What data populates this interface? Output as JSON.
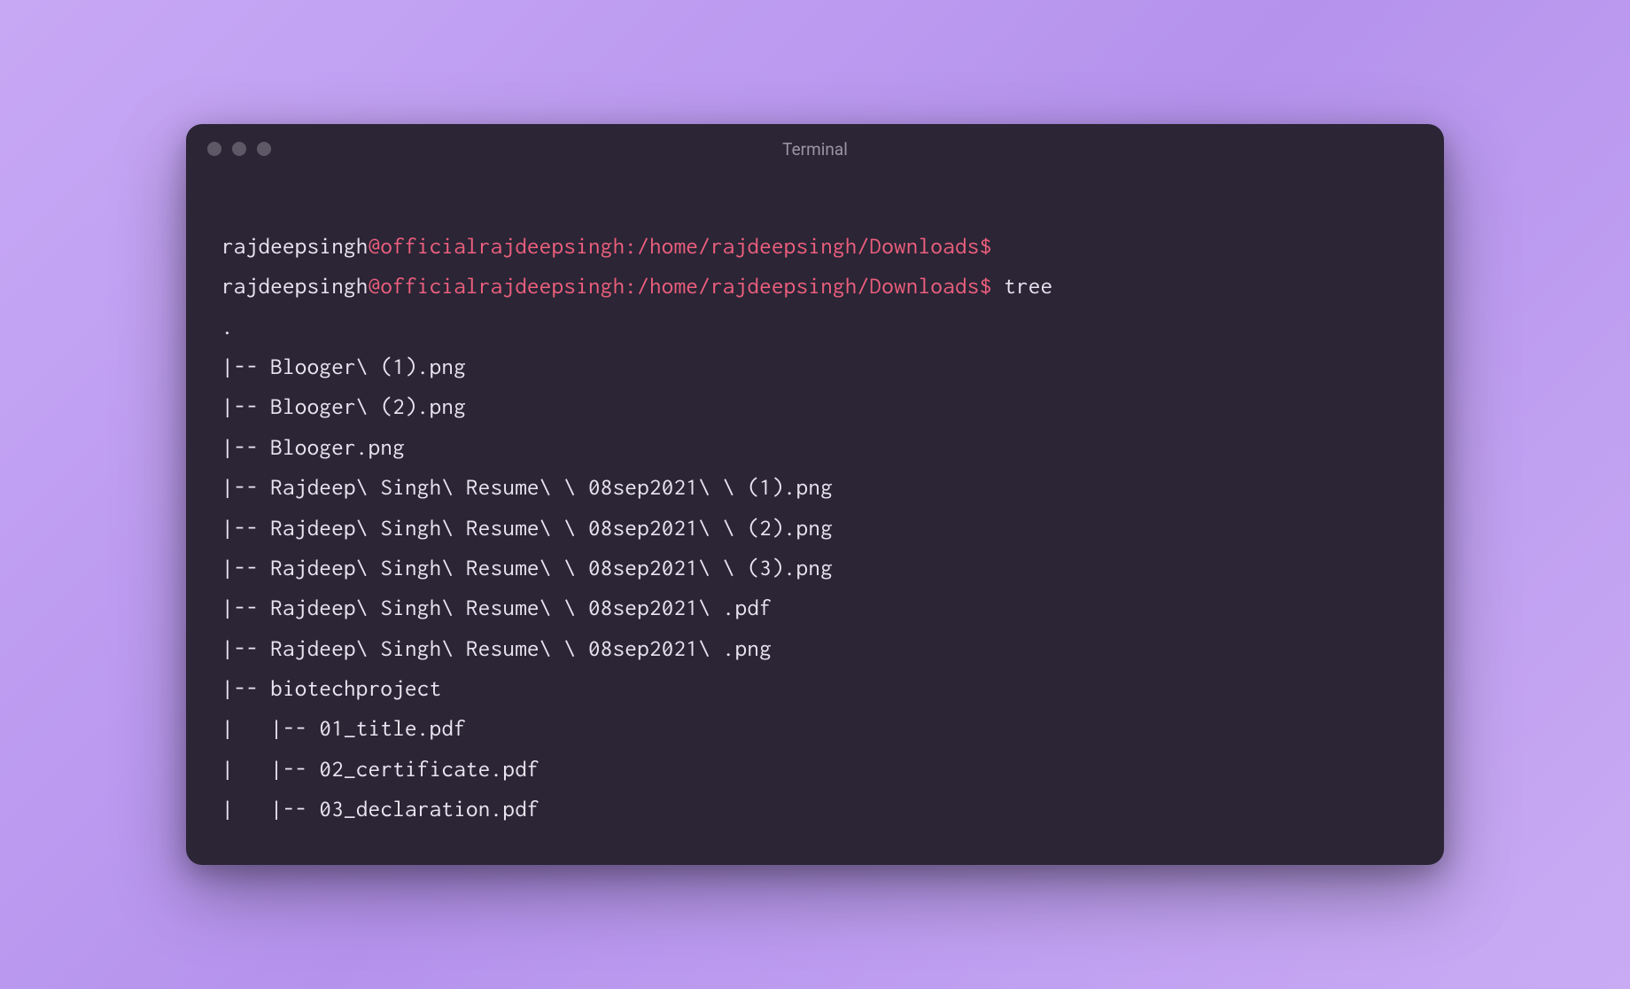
{
  "window": {
    "title": "Terminal"
  },
  "prompts": [
    {
      "user": "rajdeepsingh",
      "path": "@officialrajdeepsingh:/home/rajdeepsingh/Downloads$",
      "command": ""
    },
    {
      "user": "rajdeepsingh",
      "path": "@officialrajdeepsingh:/home/rajdeepsingh/Downloads$",
      "command": " tree"
    }
  ],
  "output_lines": [
    ".",
    "|-- Blooger\\ (1).png",
    "|-- Blooger\\ (2).png",
    "|-- Blooger.png",
    "|-- Rajdeep\\ Singh\\ Resume\\ \\ 08sep2021\\ \\ (1).png",
    "|-- Rajdeep\\ Singh\\ Resume\\ \\ 08sep2021\\ \\ (2).png",
    "|-- Rajdeep\\ Singh\\ Resume\\ \\ 08sep2021\\ \\ (3).png",
    "|-- Rajdeep\\ Singh\\ Resume\\ \\ 08sep2021\\ .pdf",
    "|-- Rajdeep\\ Singh\\ Resume\\ \\ 08sep2021\\ .png",
    "|-- biotechproject",
    "|   |-- 01_title.pdf",
    "|   |-- 02_certificate.pdf",
    "|   |-- 03_declaration.pdf"
  ]
}
